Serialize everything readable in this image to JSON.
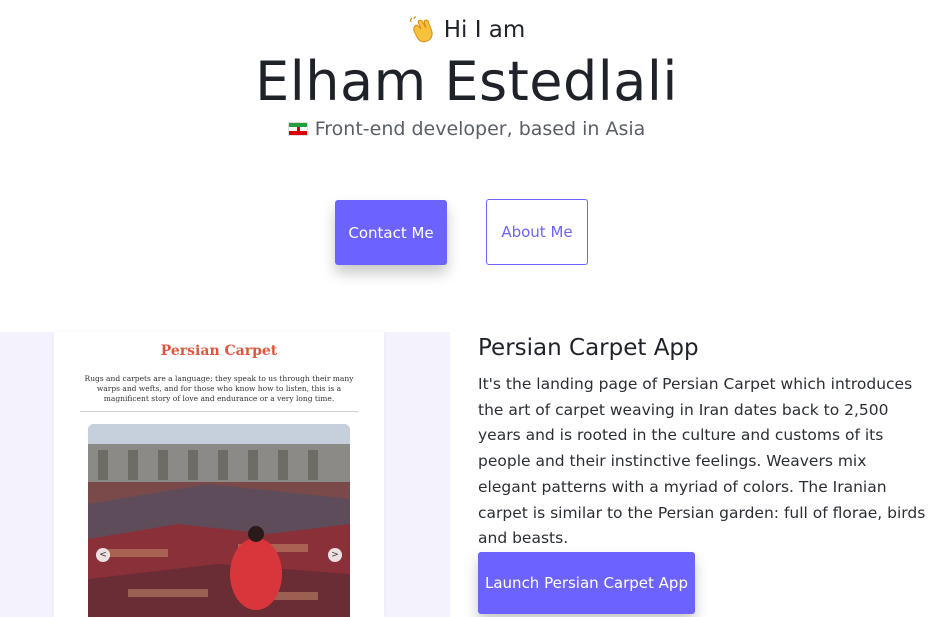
{
  "hero": {
    "greeting": "Hi I am",
    "greeting_icon": "waving-hand-icon",
    "name": "Elham Estedlali",
    "subtitle": "Front-end developer, based in Asia",
    "subtitle_icon": "iran-flag-icon"
  },
  "buttons": {
    "contact": "Contact Me",
    "about": "About Me"
  },
  "project": {
    "title": "Persian Carpet App",
    "description": "It's the landing page of Persian Carpet which introduces the art of carpet weaving in Iran dates back to 2,500 years and is rooted in the culture and customs of its people and their instinctive feelings. Weavers mix elegant patterns with a myriad of colors. The Iranian carpet is similar to the Persian garden: full of florae, birds and beasts.",
    "launch_label": "Launch Persian Carpet App",
    "preview": {
      "title": "Persian Carpet",
      "quote": "Rugs and carpets are a language; they speak to us through their many warps and wefts, and for those who know how to listen, this is a magnificent story of love and endurance or a very long time.",
      "arrow_left": "<",
      "arrow_right": ">"
    }
  },
  "colors": {
    "accent": "#6c63ff",
    "preview_title": "#e2553c",
    "preview_bg": "#f4f3fd"
  }
}
